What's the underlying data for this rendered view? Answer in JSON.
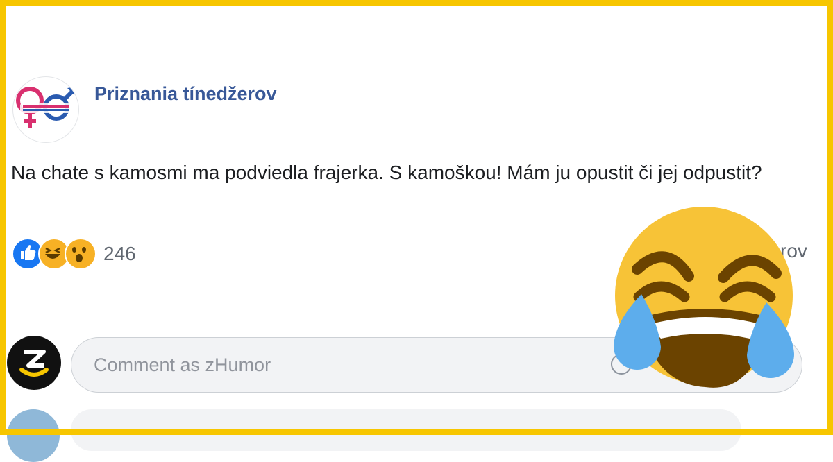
{
  "post": {
    "page_name": "Priznania tínedžerov",
    "text": "Na chate s kamosmi ma podviedla frajerka. S kamoškou! Mám ju opustit či jej odpustit?",
    "reaction_icons": [
      "like-icon",
      "haha-icon",
      "wow-icon"
    ],
    "reaction_count": "246",
    "share_partial": "rov"
  },
  "comment_input": {
    "placeholder": "Comment as zHumor"
  },
  "colors": {
    "frame": "#f7c600",
    "page_name": "#385898",
    "like": "#1877f2",
    "emoji_face": "#f7c337",
    "tear": "#5dadec"
  },
  "overlay_emoji": "face-with-tears-of-joy-icon"
}
